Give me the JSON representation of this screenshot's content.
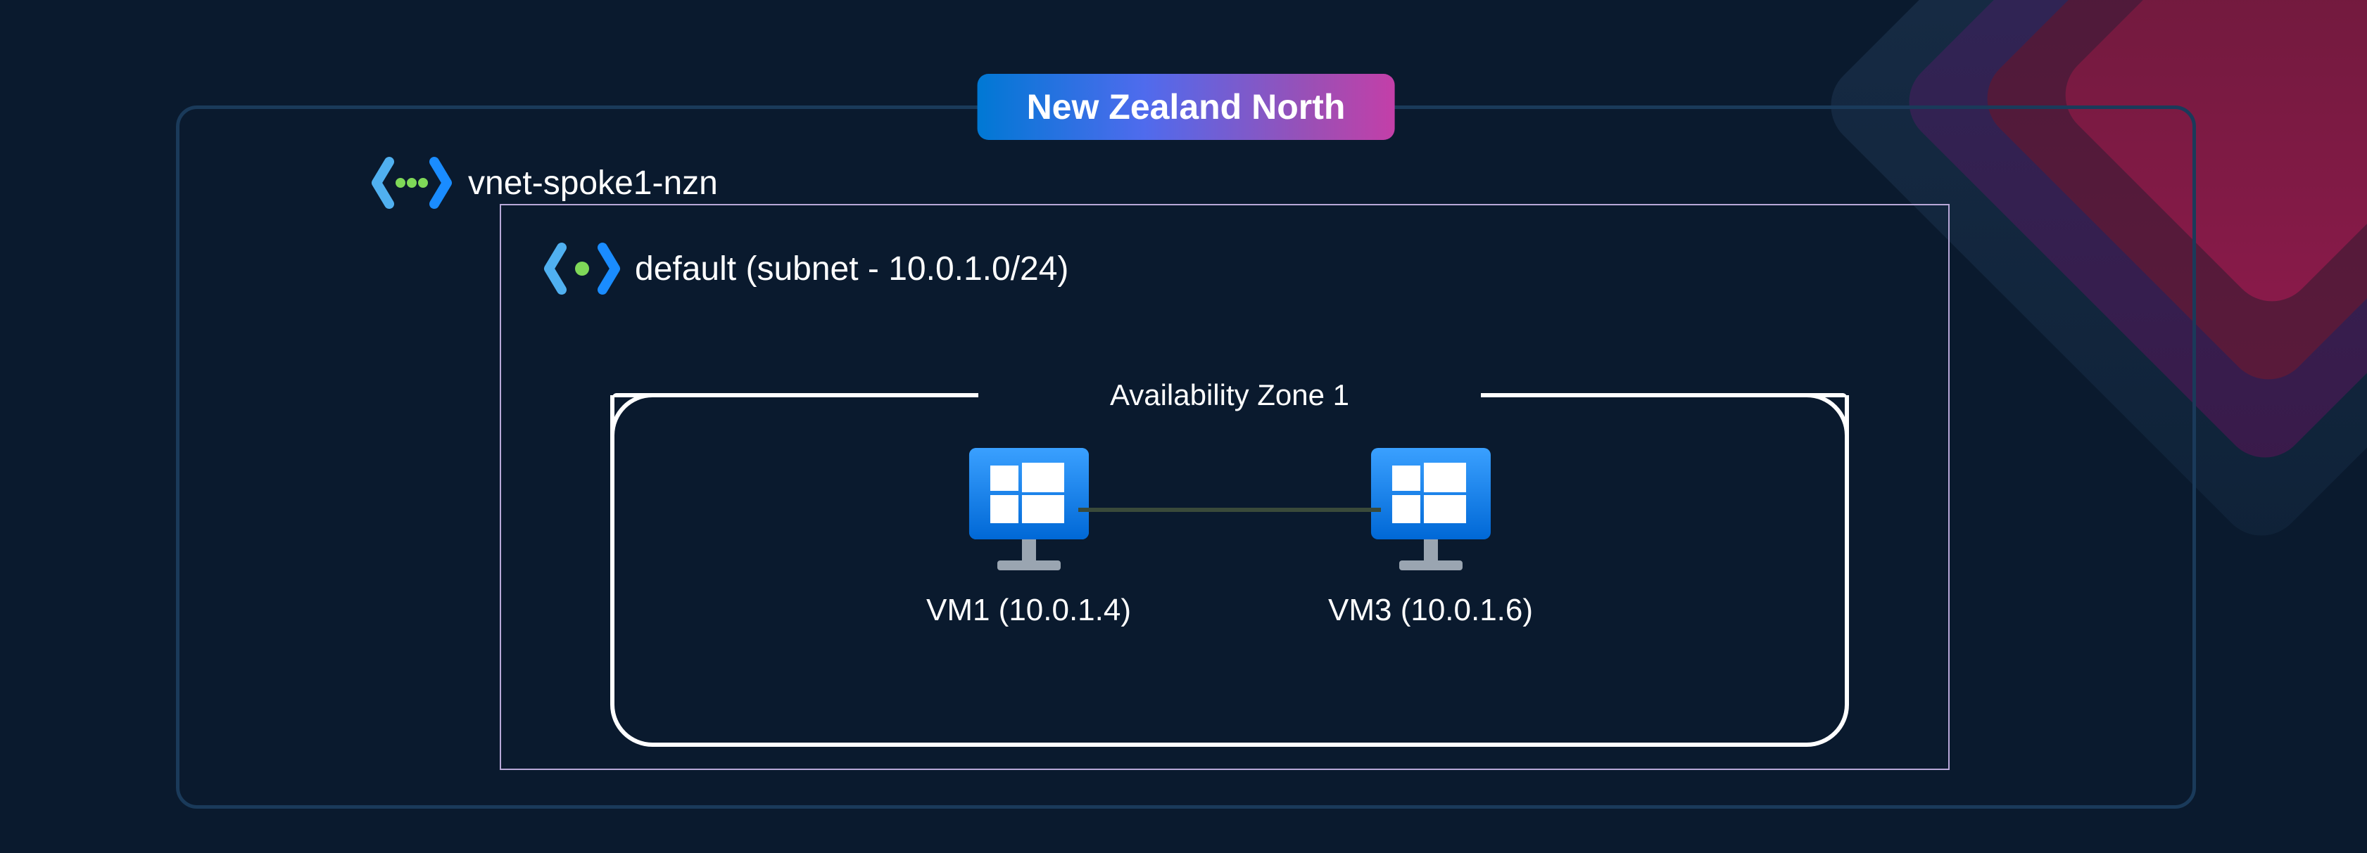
{
  "region": {
    "name": "New Zealand North"
  },
  "vnet": {
    "name": "vnet-spoke1-nzn"
  },
  "subnet": {
    "label": "default (subnet - 10.0.1.0/24)"
  },
  "zone": {
    "label": "Availability Zone 1"
  },
  "vms": [
    {
      "label": "VM1 (10.0.1.4)"
    },
    {
      "label": "VM3 (10.0.1.6)"
    }
  ]
}
